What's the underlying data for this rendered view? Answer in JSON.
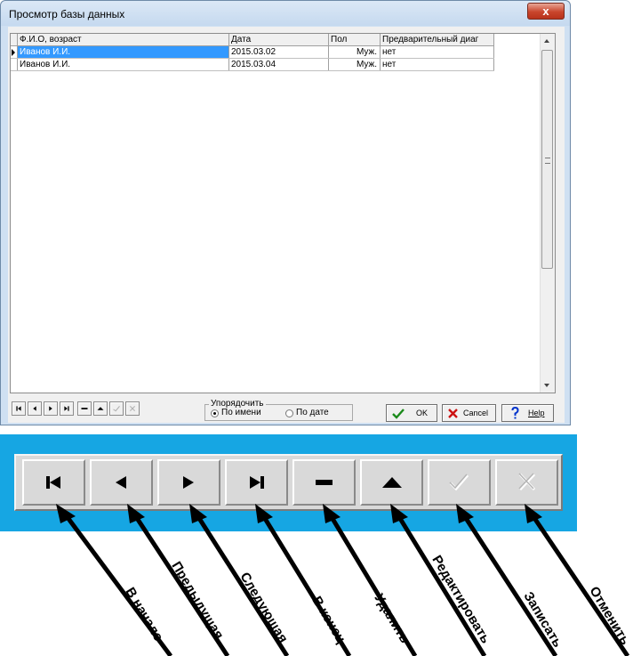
{
  "window": {
    "title": "Просмотр базы данных",
    "close_glyph": "x"
  },
  "grid": {
    "columns": [
      "Ф.И.О, возраст",
      "Дата",
      "Пол",
      "Предварительный диаг"
    ],
    "rows": [
      {
        "name": "Иванов И.И.",
        "date": "2015.03.02",
        "sex": "Муж.",
        "diag": "нет",
        "selected": true
      },
      {
        "name": "Иванов И.И.",
        "date": "2015.03.04",
        "sex": "Муж.",
        "diag": "нет",
        "selected": false
      }
    ]
  },
  "navigator": {
    "buttons": [
      {
        "id": "first",
        "icon": "first-record-icon",
        "enabled": true
      },
      {
        "id": "prior",
        "icon": "prior-record-icon",
        "enabled": true
      },
      {
        "id": "next",
        "icon": "next-record-icon",
        "enabled": true
      },
      {
        "id": "last",
        "icon": "last-record-icon",
        "enabled": true
      },
      {
        "id": "delete",
        "icon": "delete-record-icon",
        "enabled": true
      },
      {
        "id": "edit",
        "icon": "edit-record-icon",
        "enabled": true
      },
      {
        "id": "post",
        "icon": "post-record-icon",
        "enabled": false
      },
      {
        "id": "cancel",
        "icon": "cancel-record-icon",
        "enabled": false
      }
    ]
  },
  "sort": {
    "legend": "Упорядочить",
    "options": [
      {
        "label": "По имени",
        "checked": true
      },
      {
        "label": "По дате",
        "checked": false
      }
    ]
  },
  "buttons": {
    "ok": "OK",
    "cancel": "Cancel",
    "help": "Help"
  },
  "callouts": [
    "В начало",
    "Предыдущая",
    "Следующая",
    "В конец",
    "Удалить",
    "Редактировать",
    "Записать",
    "Отменить"
  ],
  "colors": {
    "selection": "#3399ff",
    "banner": "#16a6e3",
    "ok_check": "#1a8a1a",
    "cancel_x": "#cc1111",
    "help_mark": "#0033cc"
  }
}
